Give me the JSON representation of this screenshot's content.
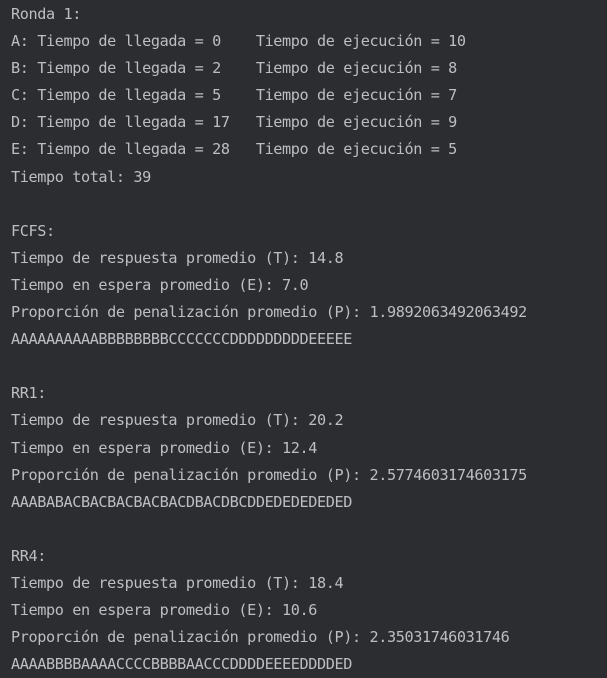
{
  "console": {
    "lines": [
      "Ronda 1:",
      "A: Tiempo de llegada = 0    Tiempo de ejecución = 10",
      "B: Tiempo de llegada = 2    Tiempo de ejecución = 8",
      "C: Tiempo de llegada = 5    Tiempo de ejecución = 7",
      "D: Tiempo de llegada = 17   Tiempo de ejecución = 9",
      "E: Tiempo de llegada = 28   Tiempo de ejecución = 5",
      "Tiempo total: 39",
      "",
      "FCFS:",
      "Tiempo de respuesta promedio (T): 14.8",
      "Tiempo en espera promedio (E): 7.0",
      "Proporción de penalización promedio (P): 1.9892063492063492",
      "AAAAAAAAAABBBBBBBBCCCCCCCDDDDDDDDDEEEEE",
      "",
      "RR1:",
      "Tiempo de respuesta promedio (T): 20.2",
      "Tiempo en espera promedio (E): 12.4",
      "Proporción de penalización promedio (P): 2.5774603174603175",
      "AAABABACBACBACBACBACDBACDBCDDEDEDEDEDED",
      "",
      "RR4:",
      "Tiempo de respuesta promedio (T): 18.4",
      "Tiempo en espera promedio (E): 10.6",
      "Proporción de penalización promedio (P): 2.35031746031746",
      "AAAABBBBAAAACCCCBBBBAACCCDDDDEEEEDDDDED"
    ]
  },
  "colors": {
    "background": "#2b2d30",
    "text": "#bcbec4"
  }
}
